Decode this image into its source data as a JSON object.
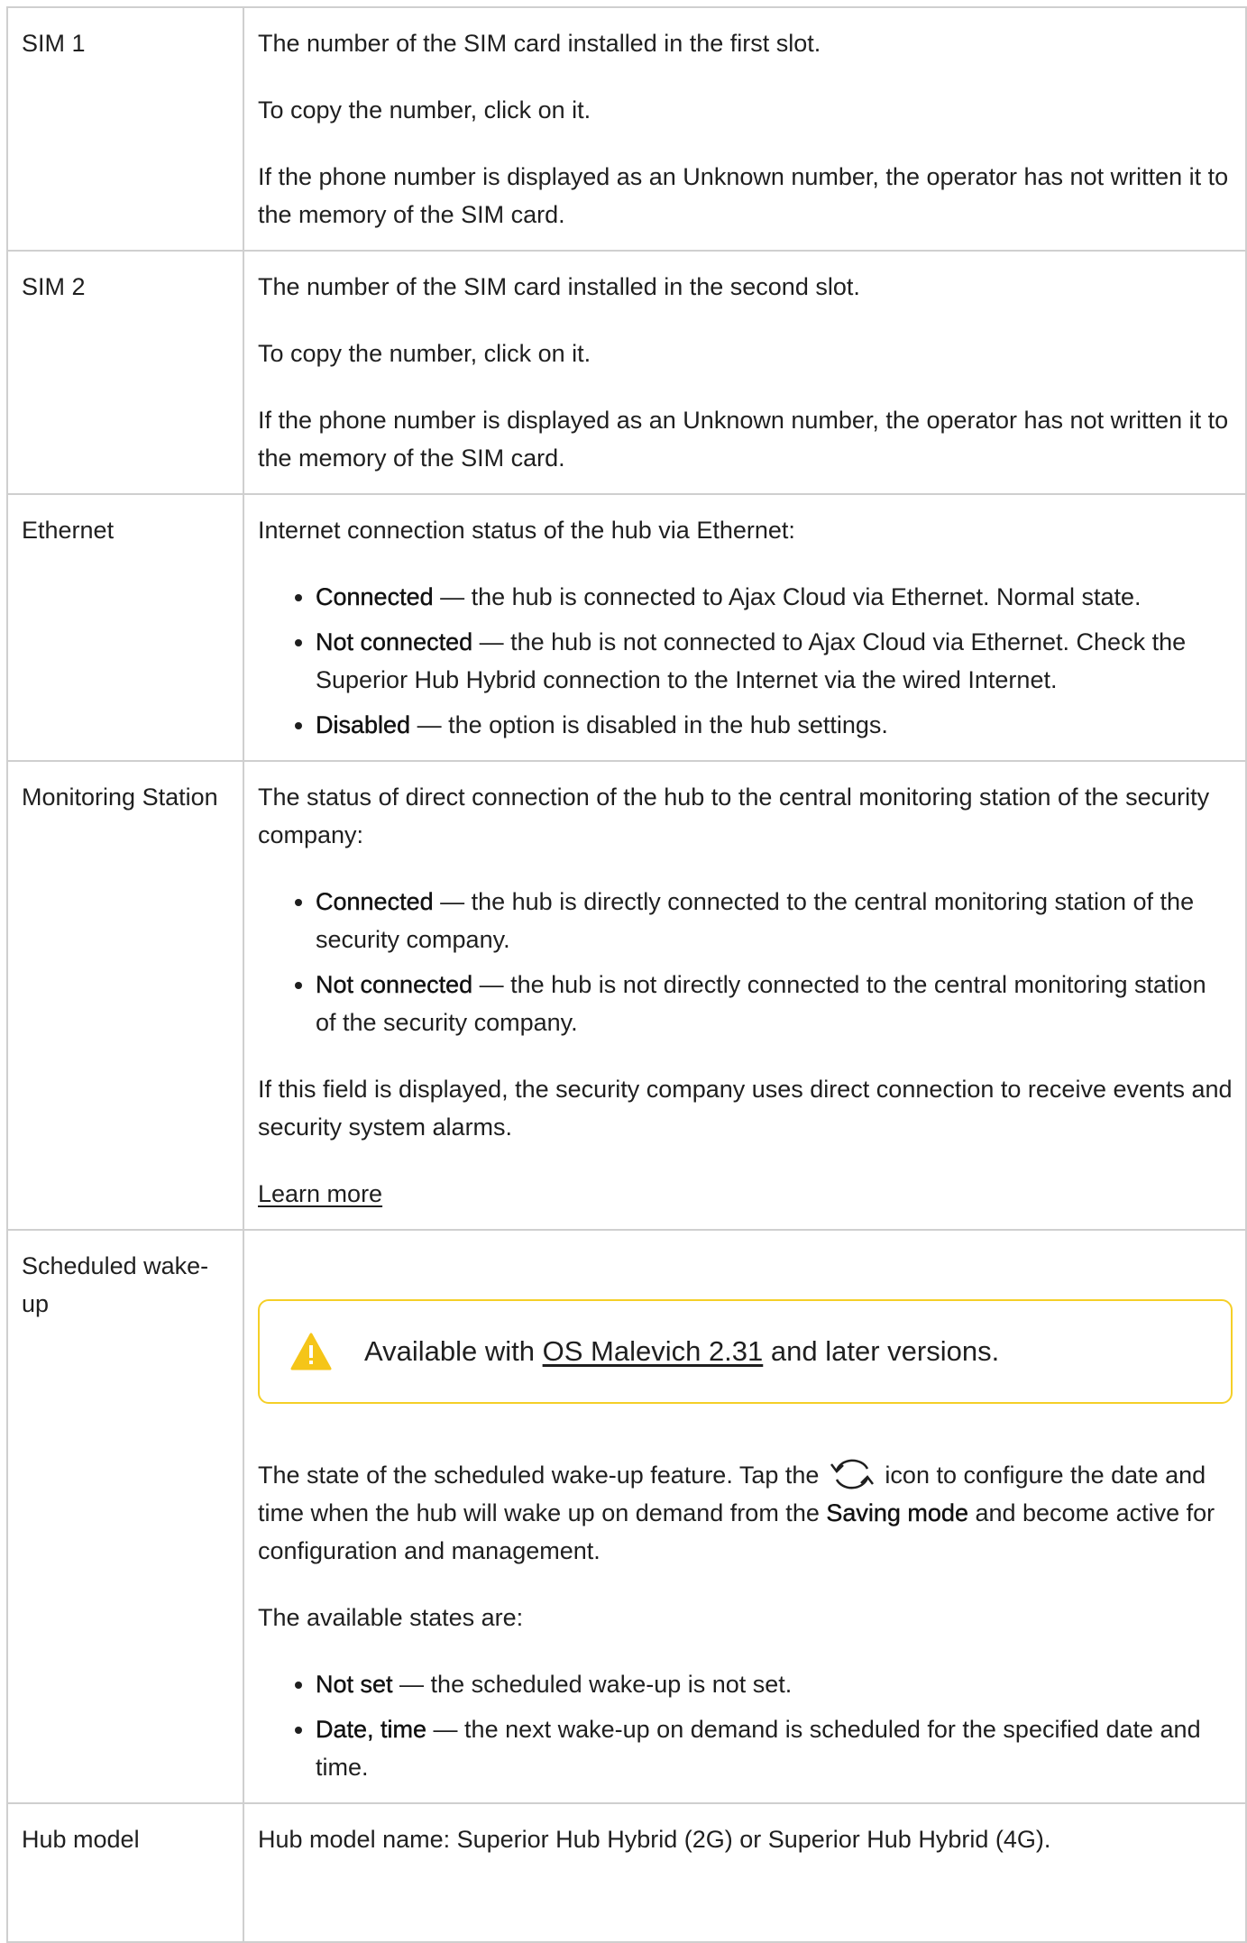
{
  "rows": [
    {
      "label": "SIM 1",
      "p1": "The number of the SIM card installed in the first slot.",
      "p2": "To copy the number, click on it.",
      "p3": "If the phone number is displayed as an Unknown number, the operator has not written it to the memory of the SIM card."
    },
    {
      "label": "SIM 2",
      "p1": "The number of the SIM card installed in the second slot.",
      "p2": "To copy the number, click on it.",
      "p3": "If the phone number is displayed as an Unknown number, the operator has not written it to the memory of the SIM card."
    },
    {
      "label": "Ethernet",
      "intro": "Internet connection status of the hub via Ethernet:",
      "items": [
        {
          "term": "Connected",
          "text": " — the hub is connected to Ajax Cloud via Ethernet. Normal state."
        },
        {
          "term": "Not connected",
          "text": " — the hub is not connected to Ajax Cloud via Ethernet. Check the Superior Hub Hybrid connection to the Internet via the wired Internet."
        },
        {
          "term": "Disabled",
          "text": " — the option is disabled in the hub settings."
        }
      ]
    },
    {
      "label": "Monitoring Station",
      "intro": "The status of direct connection of the hub to the central monitoring station of the security company:",
      "items": [
        {
          "term": "Connected",
          "text": " — the hub is directly connected to the central monitoring station of the security company."
        },
        {
          "term": "Not connected",
          "text": " — the hub is not directly connected to the central monitoring station of the security company."
        }
      ],
      "note": "If this field is displayed, the security company uses direct connection to receive events and security system alarms.",
      "link": "Learn more"
    },
    {
      "label": "Scheduled wake-up",
      "callout": {
        "prefix": "Available with ",
        "link": "OS Malevich 2.31",
        "suffix": " and later versions."
      },
      "desc_prefix": "The state of the scheduled wake-up feature. Tap the ",
      "desc_mid": " icon to configure the date and time when the hub will wake up on demand from the ",
      "desc_term": "Saving mode",
      "desc_suffix": " and become active for configuration and management.",
      "states_intro": "The available states are:",
      "items": [
        {
          "term": "Not set",
          "text": " — the scheduled wake-up is not set."
        },
        {
          "term": "Date, time",
          "text": " — the next wake-up on demand is scheduled for the specified date and time."
        }
      ]
    },
    {
      "label": "Hub model",
      "p1": "Hub model name: Superior Hub Hybrid (2G) or Superior Hub Hybrid (4G)."
    }
  ],
  "icons": {
    "warning": "warning-triangle-icon",
    "refresh": "refresh-icon"
  },
  "colors": {
    "border": "#cfcfcf",
    "callout_border": "#f5cf27",
    "warning_fill": "#f5c518",
    "text": "#1f1f1f"
  }
}
